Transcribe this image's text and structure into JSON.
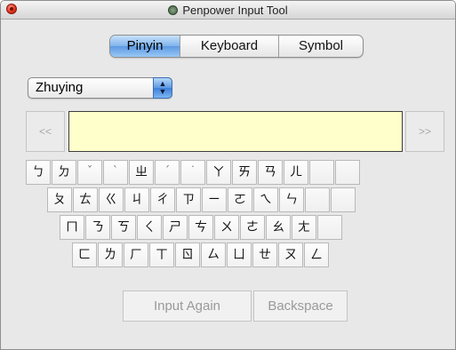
{
  "window": {
    "title": "Penpower Input Tool"
  },
  "tabs": [
    {
      "label": "Pinyin",
      "active": true
    },
    {
      "label": "Keyboard",
      "active": false
    },
    {
      "label": "Symbol",
      "active": false
    }
  ],
  "input_method": {
    "selected": "Zhuying"
  },
  "candidates": {
    "prev_label": "<<",
    "next_label": ">>",
    "text": ""
  },
  "keyboard": {
    "rows": [
      [
        "ㄅ",
        "ㄉ",
        "ˇ",
        "ˋ",
        "ㄓ",
        "ˊ",
        "˙",
        "ㄚ",
        "ㄞ",
        "ㄢ",
        "ㄦ",
        "",
        ""
      ],
      [
        "ㄆ",
        "ㄊ",
        "ㄍ",
        "ㄐ",
        "ㄔ",
        "ㄗ",
        "ㄧ",
        "ㄛ",
        "ㄟ",
        "ㄣ",
        "",
        ""
      ],
      [
        "ㄇ",
        "ㄋ",
        "ㄎ",
        "ㄑ",
        "ㄕ",
        "ㄘ",
        "ㄨ",
        "ㄜ",
        "ㄠ",
        "ㄤ",
        ""
      ],
      [
        "ㄈ",
        "ㄌ",
        "ㄏ",
        "ㄒ",
        "ㄖ",
        "ㄙ",
        "ㄩ",
        "ㄝ",
        "ㄡ",
        "ㄥ"
      ]
    ]
  },
  "actions": {
    "input_again": "Input Again",
    "backspace": "Backspace"
  }
}
